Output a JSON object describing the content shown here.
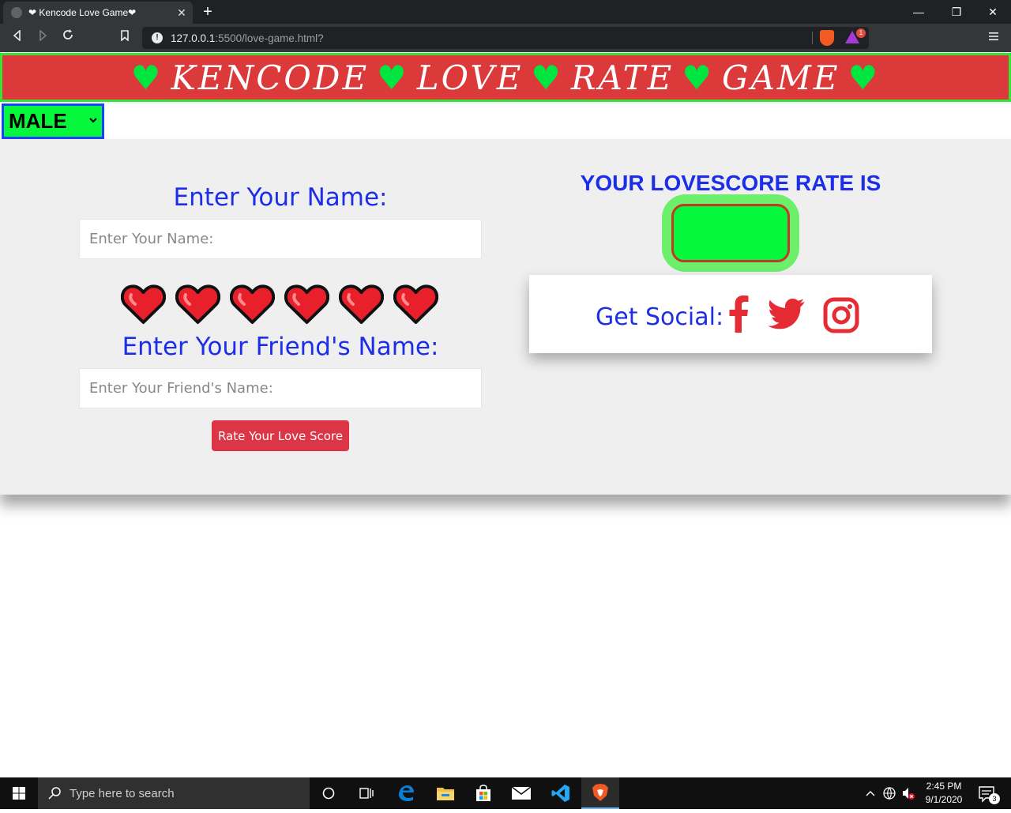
{
  "browser": {
    "tab_title": "❤ Kencode Love Game❤",
    "tab_close": "✕",
    "new_tab": "+",
    "url_host": "127.0.0.1",
    "url_rest": ":5500/love-game.html?",
    "rewards_count": "1",
    "window_min": "—",
    "window_restore": "❐",
    "window_close": "✕"
  },
  "page": {
    "banner_words": [
      "KENCODE",
      "LOVE",
      "RATE",
      "GAME"
    ],
    "banner_heart": "♥",
    "gender_selected": "MALE",
    "name_label": "Enter Your Name:",
    "name_placeholder": "Enter Your Name:",
    "friend_label": "Enter Your Friend's Name:",
    "friend_placeholder": "Enter Your Friend's Name:",
    "rate_button": "Rate Your Love Score",
    "score_title": "YOUR LOVESCORE RATE IS",
    "score_value": "",
    "social_label": "Get Social:",
    "social_icons": [
      "facebook-icon",
      "twitter-icon",
      "instagram-icon"
    ],
    "heart_count": 6
  },
  "taskbar": {
    "search_placeholder": "Type here to search",
    "time": "2:45 PM",
    "date": "9/1/2020",
    "notification_count": "3"
  },
  "colors": {
    "banner_bg": "#dc3a3a",
    "banner_border": "#33e633",
    "heading_blue": "#1d2ee8",
    "select_green": "#05f83b",
    "button_red": "#dc3545",
    "social_red": "#e52c35"
  }
}
